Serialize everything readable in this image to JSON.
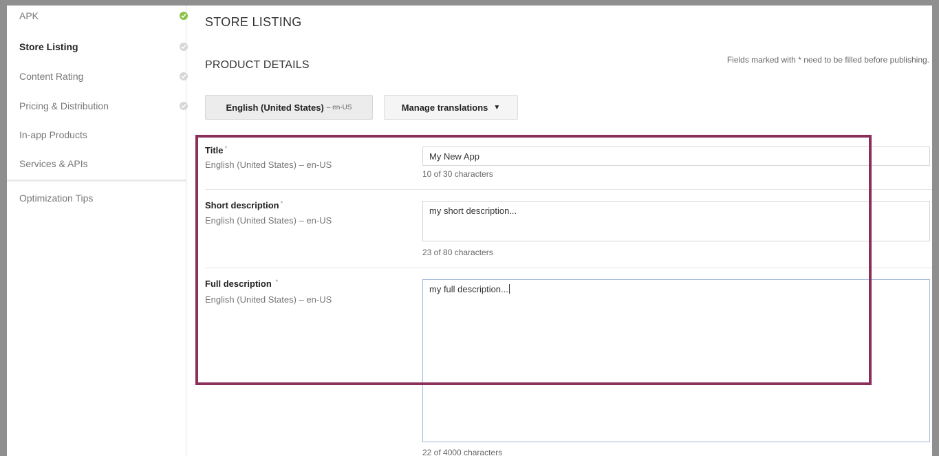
{
  "sidebar": {
    "items": [
      {
        "label": "APK",
        "status": "complete"
      },
      {
        "label": "Store Listing",
        "status": "pending",
        "active": true
      },
      {
        "label": "Content Rating",
        "status": "pending"
      },
      {
        "label": "Pricing & Distribution",
        "status": "pending"
      },
      {
        "label": "In-app Products",
        "status": "none"
      },
      {
        "label": "Services & APIs",
        "status": "none"
      }
    ],
    "secondary": [
      {
        "label": "Optimization Tips"
      }
    ]
  },
  "main": {
    "page_title": "STORE LISTING",
    "section_title": "PRODUCT DETAILS",
    "required_note": "Fields marked with * need to be filled before publishing.",
    "language_button": {
      "label": "English (United States)",
      "code": "– en-US"
    },
    "manage_translations": {
      "label": "Manage translations",
      "icon": "caret-down-icon"
    },
    "fields": [
      {
        "label": "Title",
        "required_mark": "*",
        "language": "English (United States) – en-US",
        "value": "My New App",
        "char_count": "10 of 30 characters"
      },
      {
        "label": "Short description",
        "required_mark": "*",
        "language": "English (United States) – en-US",
        "value": "my short description...",
        "char_count": "23 of 80 characters"
      },
      {
        "label": "Full description",
        "required_mark": "*",
        "language": "English (United States) – en-US",
        "value": "my full description...",
        "char_count": "22 of 4000 characters"
      }
    ]
  },
  "colors": {
    "highlight": "#8b2f5a",
    "complete": "#8bc34a",
    "pending": "#d7d7d7"
  }
}
